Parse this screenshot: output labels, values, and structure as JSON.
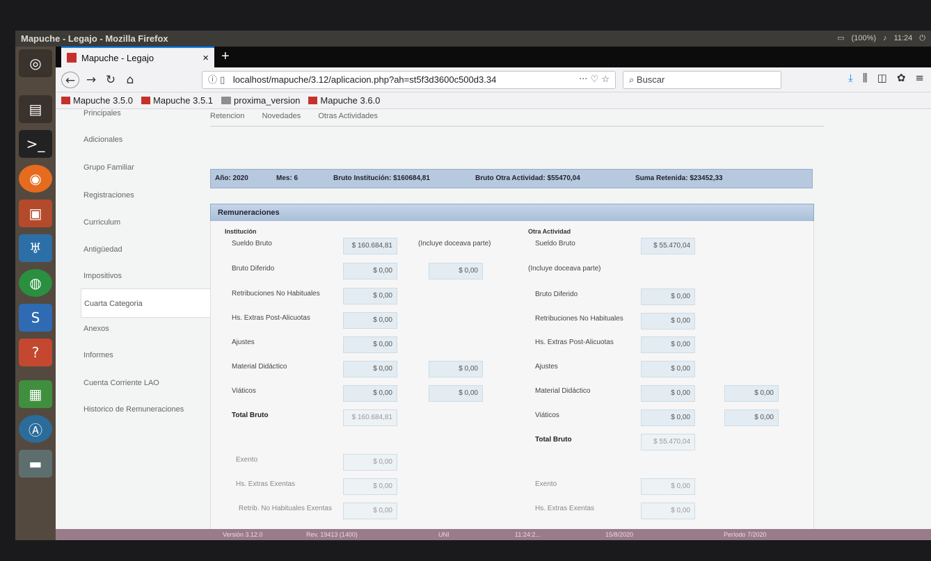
{
  "os": {
    "window_title": "Mapuche - Legajo - Mozilla Firefox",
    "tray": [
      "(100%)",
      "11:24"
    ]
  },
  "browser": {
    "tab_title": "Mapuche - Legajo",
    "tab_close": "×",
    "new_tab": "+",
    "url": "localhost/mapuche/3.12/aplicacion.php?ah=st5f3d3600c500d3.34",
    "url_actions": "··· ♡ ☆",
    "search_placeholder": "Buscar",
    "bookmarks": [
      "Mapuche 3.5.0",
      "Mapuche 3.5.1",
      "proxima_version",
      "Mapuche 3.6.0"
    ]
  },
  "side_menu": {
    "items": [
      {
        "label": "Principales"
      },
      {
        "label": "Adicionales"
      },
      {
        "label": "Grupo Familiar"
      },
      {
        "label": "Registraciones"
      },
      {
        "label": "Curriculum"
      },
      {
        "label": "Antigüedad"
      },
      {
        "label": "Impositivos"
      },
      {
        "label": "Cuarta Categoria"
      },
      {
        "label": "Anexos"
      },
      {
        "label": "Informes"
      },
      {
        "label": "Cuenta Corriente LAO"
      },
      {
        "label": "Historico de Remuneraciones"
      }
    ]
  },
  "subtabs": [
    "Retencion",
    "Novedades",
    "Otras Actividades"
  ],
  "info": {
    "anio": "Año: 2020",
    "mes": "Mes: 6",
    "bruto_inst": "Bruto Institución: $160684,81",
    "bruto_otra": "Bruto Otra Actividad: $55470,04",
    "suma_ret": "Suma Retenida: $23452,33"
  },
  "section_title": "Remuneraciones",
  "institucion": {
    "title": "Institución",
    "incluye": "(Incluye doceava parte)",
    "rows": [
      {
        "label": "Sueldo Bruto",
        "value": "$ 160.684,81"
      },
      {
        "label": "Bruto Diferido",
        "value": "$ 0,00",
        "extra": "$ 0,00"
      },
      {
        "label": "Retribuciones No Habituales",
        "value": "$ 0,00"
      },
      {
        "label": "Hs. Extras Post-Alicuotas",
        "value": "$ 0,00"
      },
      {
        "label": "Ajustes",
        "value": "$ 0,00"
      },
      {
        "label": "Material Didáctico",
        "value": "$ 0,00",
        "extra": "$ 0,00"
      },
      {
        "label": "Viáticos",
        "value": "$ 0,00",
        "extra": "$ 0,00"
      },
      {
        "label": "Total Bruto",
        "value": "$ 160.684,81"
      },
      {
        "label": "Exento",
        "value": "$ 0,00"
      },
      {
        "label": "Hs. Extras Exentas",
        "value": "$ 0,00"
      },
      {
        "label": "Retrib. No Habituales Exentas",
        "value": "$ 0,00"
      }
    ]
  },
  "otra": {
    "title": "Otra Actividad",
    "incluye": "(Incluye doceava parte)",
    "rows": [
      {
        "label": "Sueldo Bruto",
        "value": "$ 55.470,04"
      },
      {
        "label": "Bruto Diferido",
        "value": "$ 0,00"
      },
      {
        "label": "Retribuciones No Habituales",
        "value": "$ 0,00"
      },
      {
        "label": "Hs. Extras Post-Alicuotas",
        "value": "$ 0,00"
      },
      {
        "label": "Ajustes",
        "value": "$ 0,00"
      },
      {
        "label": "Material Didáctico",
        "value": "$ 0,00",
        "extra": "$ 0,00"
      },
      {
        "label": "Viáticos",
        "value": "$ 0,00",
        "extra": "$ 0,00"
      },
      {
        "label": "Total Bruto",
        "value": "$ 55.470,04"
      },
      {
        "label": "Exento",
        "value": "$ 0,00"
      },
      {
        "label": "Hs. Extras Exentas",
        "value": "$ 0,00"
      }
    ]
  },
  "status": {
    "version": "Versión 3.12.0",
    "rev": "Rev. 19413 (1400)",
    "uni": "UNI",
    "time": "11:24:2...",
    "date": "15/8/2020",
    "periodo": "Período 7/2020"
  }
}
